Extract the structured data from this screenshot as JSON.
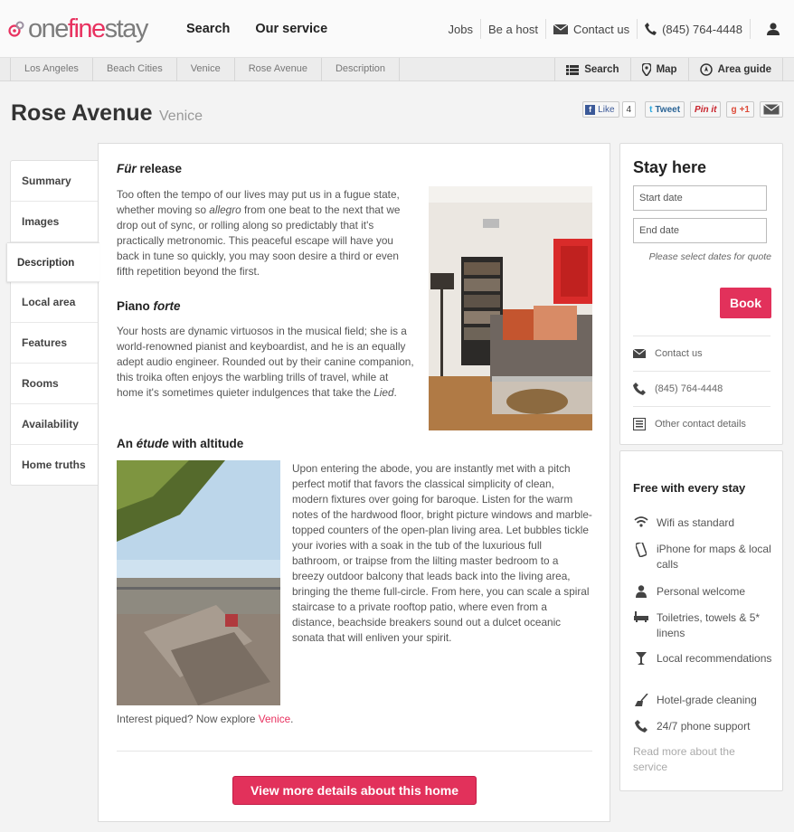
{
  "header": {
    "logo": {
      "pre": "one",
      "mid": "fine",
      "post": "stay"
    },
    "nav": [
      "Search",
      "Our service"
    ],
    "right": {
      "jobs": "Jobs",
      "host": "Be a host",
      "contact": "Contact us",
      "phone": "(845) 764-4448"
    }
  },
  "breadcrumb": [
    "Los Angeles",
    "Beach Cities",
    "Venice",
    "Rose Avenue",
    "Description"
  ],
  "tools": {
    "search": "Search",
    "map": "Map",
    "guide": "Area guide"
  },
  "title": {
    "name": "Rose Avenue",
    "area": "Venice"
  },
  "share": {
    "like": "Like",
    "like_count": "4",
    "tweet": "Tweet",
    "pin": "Pin it",
    "gplus": "+1"
  },
  "tabs": [
    "Summary",
    "Images",
    "Description",
    "Local area",
    "Features",
    "Rooms",
    "Availability",
    "Home truths"
  ],
  "content": {
    "s1_title_em": "Für",
    "s1_title_rest": " release",
    "s1_text_a": "Too often the tempo of our lives may put us in a fugue state, whether moving so ",
    "s1_text_em": "allegro",
    "s1_text_b": " from one beat to the next that we drop out of sync, or rolling along so predictably that it's practically metronomic. This peaceful escape will have you back in tune so quickly, you may soon desire a third or even fifth repetition beyond the first.",
    "s2_title_a": "Piano ",
    "s2_title_em": "forte",
    "s2_text_a": "Your hosts are dynamic virtuosos in the musical field; she is a world-renowned pianist and keyboardist, and he is an equally adept audio engineer. Rounded out by their canine companion, this troika often enjoys the warbling trills of travel, while at home it's sometimes quieter indulgences that take the ",
    "s2_text_em": "Lied",
    "s2_text_b": ".",
    "s3_title_a": "An ",
    "s3_title_em": "étude",
    "s3_title_b": " with altitude",
    "s3_text": "Upon entering the abode, you are instantly met with a pitch perfect motif that favors the classical simplicity of clean, modern fixtures over going for baroque. Listen for the warm notes of the hardwood floor, bright picture windows and marble-topped counters of the open-plan living area. Let bubbles tickle your ivories with a soak in the tub of the luxurious full bathroom, or traipse from the lilting master bedroom to a breezy outdoor balcony that leads back into the living area, bringing the theme full-circle. From here, you can scale a spiral staircase to a private rooftop patio, where even from a distance, beachside breakers sound out a dulcet oceanic sonata that will enliven your spirit.",
    "explore_text": "Interest piqued? Now explore ",
    "explore_link": "Venice",
    "explore_end": ".",
    "cta": "View more details about this home"
  },
  "stay": {
    "title": "Stay here",
    "start_placeholder": "Start date",
    "end_placeholder": "End date",
    "note": "Please select dates for quote",
    "book": "Book",
    "contact": "Contact us",
    "phone": "(845) 764-4448",
    "other": "Other contact details"
  },
  "free": {
    "title": "Free with every stay",
    "items": [
      {
        "icon": "wifi-icon",
        "text": "Wifi as standard"
      },
      {
        "icon": "phone-icon",
        "text": "iPhone for maps & local calls"
      },
      {
        "icon": "person-icon",
        "text": "Personal welcome"
      },
      {
        "icon": "bath-icon",
        "text": "Toiletries, towels & 5* linens"
      },
      {
        "icon": "cocktail-icon",
        "text": "Local recommendations"
      },
      {
        "icon": "broom-icon",
        "text": "Hotel-grade cleaning"
      },
      {
        "icon": "handset-icon",
        "text": "24/7 phone support"
      }
    ],
    "readmore": "Read more about the service"
  },
  "colors": {
    "accent": "#e2315b",
    "text": "#333333",
    "muted": "#999999"
  }
}
